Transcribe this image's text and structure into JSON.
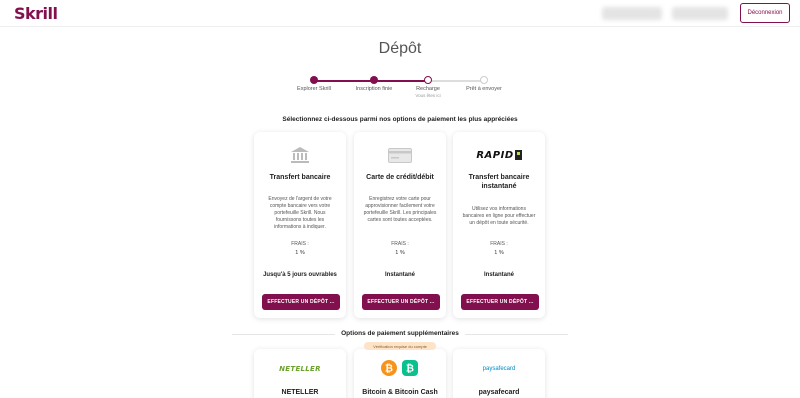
{
  "header": {
    "logo": "Skrill",
    "logout_label": "Déconnexion"
  },
  "page": {
    "title": "Dépôt"
  },
  "stepper": {
    "steps": [
      {
        "label": "Explorer Skrill",
        "sub": ""
      },
      {
        "label": "Inscription finie",
        "sub": ""
      },
      {
        "label": "Recharge",
        "sub": "Vous êtes ici"
      },
      {
        "label": "Prêt à envoyer",
        "sub": ""
      }
    ]
  },
  "primary": {
    "heading": "Sélectionnez ci-dessous parmi nos options de paiement les plus appréciées",
    "cards": [
      {
        "icon": "bank-icon",
        "title": "Transfert bancaire",
        "description": "Envoyez de l'argent de votre compte bancaire vers votre portefeuille Skrill. Nous fournissons toutes les informations à indiquer.",
        "fee_label": "FRAIS :",
        "fee_value": "1 %",
        "speed": "Jusqu'à 5 jours ouvrables",
        "cta": "EFFECTUER UN DÉPÔT ..."
      },
      {
        "icon": "credit-card-icon",
        "title": "Carte de crédit/débit",
        "description": "Enregistrez votre carte pour approvisionner facilement votre portefeuille Skrill. Les principales cartes sont toutes acceptées.",
        "fee_label": "FRAIS :",
        "fee_value": "1 %",
        "speed": "Instantané",
        "cta": "EFFECTUER UN DÉPÔT ..."
      },
      {
        "icon": "rapid-logo",
        "logo_text": "RAPID",
        "title": "Transfert bancaire instantané",
        "description": "Utilisez vos informations bancaires en ligne pour effectuer un dépôt en toute sécurité.",
        "fee_label": "FRAIS :",
        "fee_value": "1 %",
        "speed": "Instantané",
        "cta": "EFFECTUER UN DÉPÔT ..."
      }
    ]
  },
  "secondary": {
    "heading": "Options de paiement supplémentaires",
    "badge": "Vérification requise du compte",
    "cards": [
      {
        "icon": "neteller-logo",
        "logo_text": "NETELLER",
        "title": "NETELLER"
      },
      {
        "icon": "bitcoin-icon",
        "title": "Bitcoin & Bitcoin Cash"
      },
      {
        "icon": "paysafecard-logo",
        "logo_text": "paysafecard",
        "title": "paysafecard"
      }
    ]
  },
  "colors": {
    "brand": "#83104e",
    "bitcoin": "#f7931a",
    "bitcoin_cash": "#0ac18e",
    "neteller": "#8dc63f",
    "paysafecard": "#008ac9"
  }
}
